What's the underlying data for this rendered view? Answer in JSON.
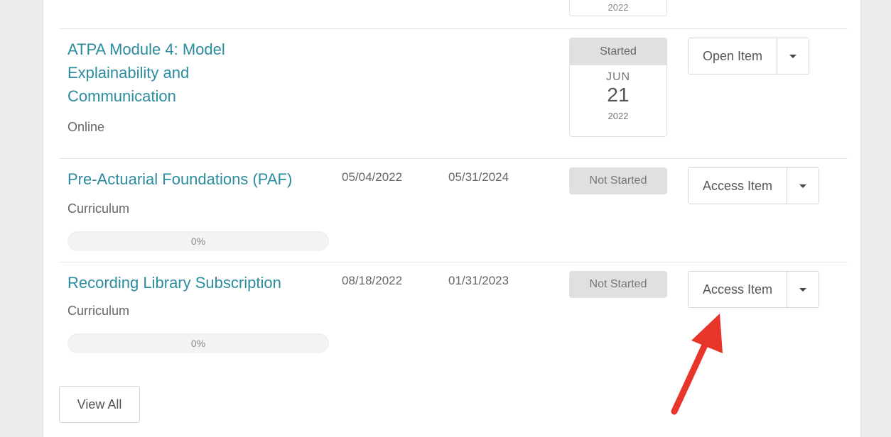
{
  "top_card": {
    "year": "2022"
  },
  "items": [
    {
      "title": "ATPA Module 4: Model Explainability and Communication",
      "type": "Online",
      "status": "Started",
      "month": "JUN",
      "day": "21",
      "year": "2022",
      "action": "Open Item"
    },
    {
      "title": "Pre-Actuarial Foundations (PAF)",
      "type": "Curriculum",
      "start_date": "05/04/2022",
      "end_date": "05/31/2024",
      "status": "Not Started",
      "progress": "0%",
      "action": "Access Item"
    },
    {
      "title": "Recording Library Subscription",
      "type": "Curriculum",
      "start_date": "08/18/2022",
      "end_date": "01/31/2023",
      "status": "Not Started",
      "progress": "0%",
      "action": "Access Item"
    }
  ],
  "view_all_label": "View All",
  "colors": {
    "link": "#2b8c9f",
    "annotation_arrow": "#e8352a"
  },
  "icons": {
    "dropdown": "caret-down-icon",
    "annotation": "red-arrow-icon"
  }
}
